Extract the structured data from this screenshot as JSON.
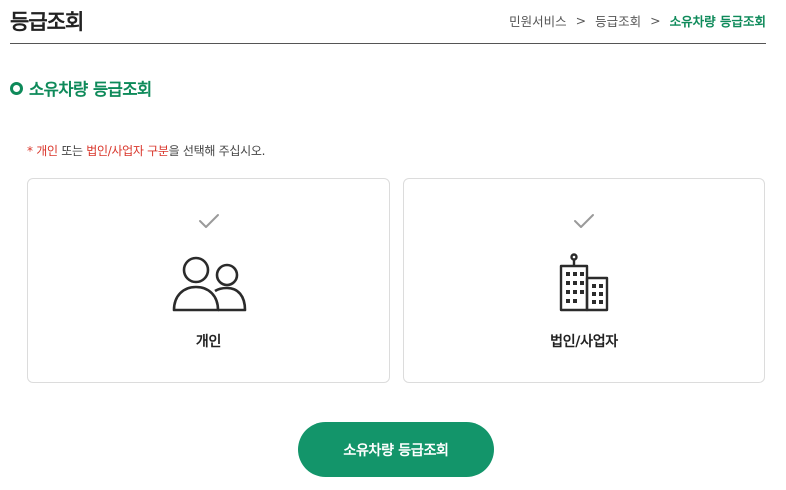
{
  "header": {
    "title": "등급조회",
    "breadcrumb": [
      "민원서비스",
      "등급조회",
      "소유차량 등급조회"
    ],
    "separator": ">"
  },
  "section": {
    "title": "소유차량 등급조회"
  },
  "notice": {
    "asterisk": "*",
    "part1": "개인",
    "part2": " 또는 ",
    "part3": "법인/사업자 구분",
    "part4": "을 선택해 주십시오."
  },
  "options": [
    {
      "label": "개인",
      "icon": "people-icon",
      "check_icon": "check-icon"
    },
    {
      "label": "법인/사업자",
      "icon": "building-icon",
      "check_icon": "check-icon"
    }
  ],
  "submit": {
    "label": "소유차량 등급조회"
  },
  "colors": {
    "accent": "#0e8a5a",
    "button": "#13956a",
    "notice_red": "#d9362b"
  }
}
